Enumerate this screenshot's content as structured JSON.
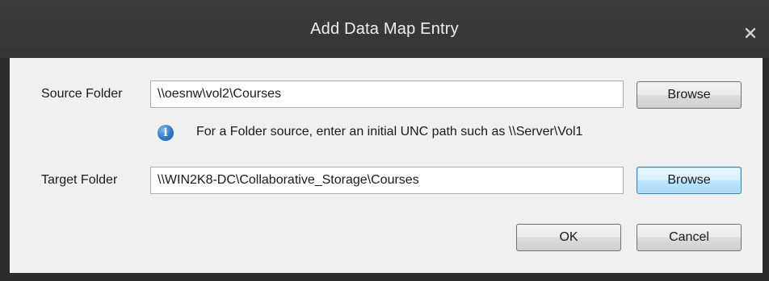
{
  "window": {
    "title": "Add Data Map Entry",
    "close_glyph": "x"
  },
  "source": {
    "label": "Source Folder",
    "value": "\\\\oesnw\\vol2\\Courses",
    "browse_label": "Browse"
  },
  "hint": {
    "icon": "info-icon",
    "text": "For a Folder source, enter an initial UNC path such as \\\\Server\\Vol1"
  },
  "target": {
    "label": "Target Folder",
    "value": "\\\\WIN2K8-DC\\Collaborative_Storage\\Courses",
    "browse_label": "Browse"
  },
  "buttons": {
    "ok_label": "OK",
    "cancel_label": "Cancel"
  }
}
